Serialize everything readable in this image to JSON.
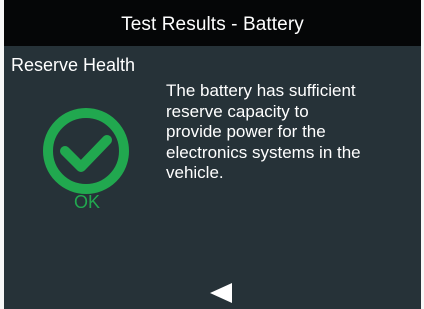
{
  "header": {
    "title": "Test Results - Battery"
  },
  "result": {
    "section_label": "Reserve Health",
    "status_icon": "checkmark-circle-icon",
    "status": "OK",
    "message": "The battery has sufficient\nreserve capacity to\nprovide power for the\nelectronics systems in the\nvehicle."
  },
  "navigation": {
    "back_icon": "left-triangle-icon"
  },
  "colors": {
    "background": "#263238",
    "header_background": "#050607",
    "success": "#21a84f",
    "text": "#ffffff"
  }
}
